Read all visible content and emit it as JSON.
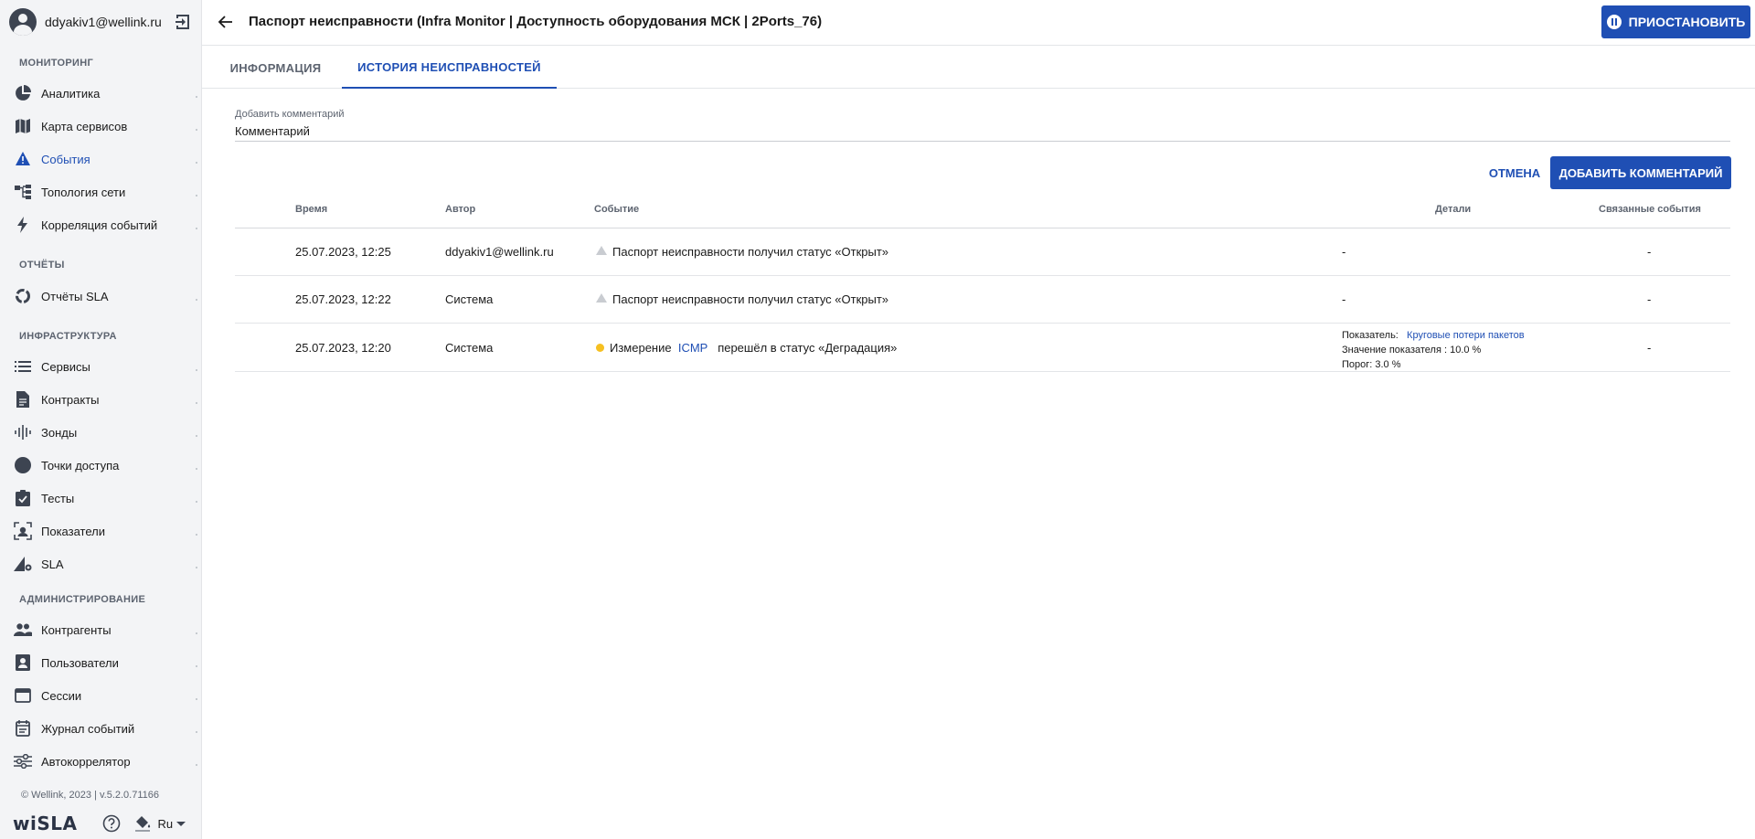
{
  "sidebar": {
    "user_email": "ddyakiv1@wellink.ru",
    "sections": {
      "monitoring": "МОНИТОРИНГ",
      "reports": "ОТЧЁТЫ",
      "infrastructure": "ИНФРАСТРУКТУРА",
      "administration": "АДМИНИСТРИРОВАНИЕ"
    },
    "items": {
      "analytics": "Аналитика",
      "service_map": "Карта сервисов",
      "events": "События",
      "network_topology": "Топология сети",
      "event_correlation": "Корреляция событий",
      "sla_reports": "Отчёты SLA",
      "services": "Сервисы",
      "contracts": "Контракты",
      "probes": "Зонды",
      "access_points": "Точки доступа",
      "tests": "Тесты",
      "metrics": "Показатели",
      "sla": "SLA",
      "counterparties": "Контрагенты",
      "users": "Пользователи",
      "sessions": "Сессии",
      "event_log": "Журнал событий",
      "autocorrelator": "Автокоррелятор"
    },
    "active_item": "events",
    "footer_copy": "© Wellink, 2023 | v.5.2.0.71166",
    "logo": "wiSLA",
    "language": "Ru"
  },
  "header": {
    "title": "Паспорт неисправности (Infra Monitor | Доступность оборудования МСК | 2Ports_76)",
    "pause_label": "ПРИОСТАНОВИТЬ"
  },
  "tabs": {
    "info": "ИНФОРМАЦИЯ",
    "history": "ИСТОРИЯ НЕИСПРАВНОСТЕЙ"
  },
  "comment": {
    "label": "Добавить комментарий",
    "placeholder": "Комментарий",
    "cancel_label": "ОТМЕНА",
    "add_label": "ДОБАВИТЬ КОММЕНТАРИЙ"
  },
  "table": {
    "columns": {
      "time": "Время",
      "author": "Автор",
      "event": "Событие",
      "details": "Детали",
      "related": "Связанные события"
    },
    "rows": [
      {
        "time": "25.07.2023, 12:25",
        "author": "ddyakiv1@wellink.ru",
        "event": "Паспорт неисправности получил статус «Открыт»",
        "details": "-",
        "related": "-"
      },
      {
        "time": "25.07.2023, 12:22",
        "author": "Система",
        "event": "Паспорт неисправности получил статус «Открыт»",
        "details": "-",
        "related": "-"
      },
      {
        "time": "25.07.2023, 12:20",
        "author": "Система",
        "event_prefix": "Измерение",
        "event_link": "ICMP",
        "event_suffix": "перешёл в статус «Деградация»",
        "details_metric_label": "Показатель:",
        "details_metric_value": "Круговые потери пакетов",
        "details_value": "Значение показателя : 10.0 %",
        "details_threshold": "Порог: 3.0 %",
        "related": "-"
      }
    ]
  },
  "colors": {
    "accent": "#1f4fb4",
    "sidebar_bg": "#f3f4f6",
    "degradation": "#f6c021"
  }
}
